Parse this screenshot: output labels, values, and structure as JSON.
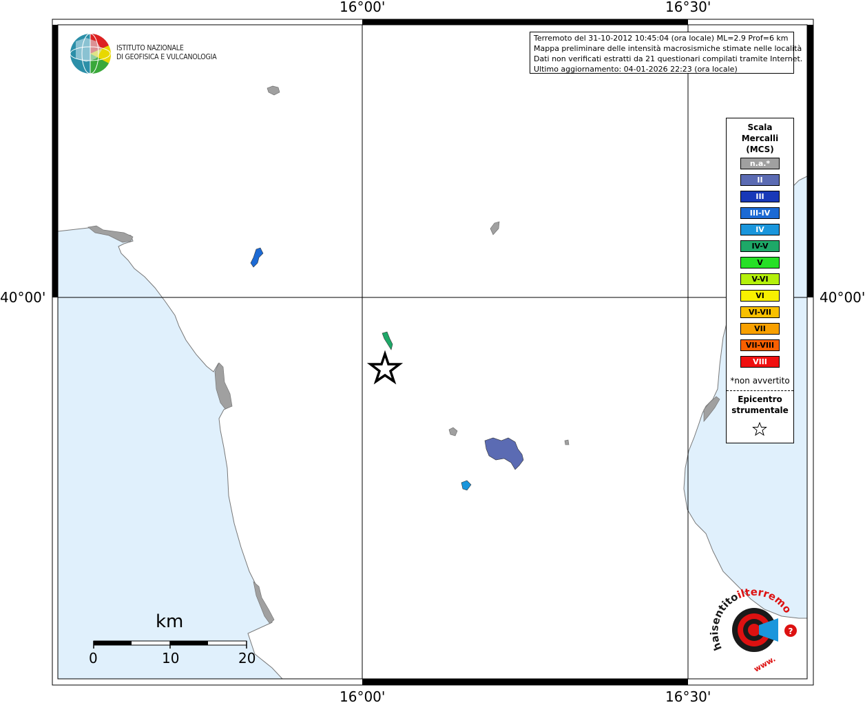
{
  "logo": {
    "line1": "ISTITUTO NAZIONALE",
    "line2": "DI GEOFISICA E VULCANOLOGIA"
  },
  "info": {
    "line1": "Terremoto del 31-10-2012 10:45:04 (ora locale) ML=2.9 Prof=6 km",
    "line2": "Mappa preliminare delle intensità macrosismiche stimate nelle località",
    "line3": "Dati non verificati estratti da 21 questionari compilati tramite Internet.",
    "line4": "Ultimo aggiornamento: 04-01-2026 22:23 (ora locale)"
  },
  "axes": {
    "lon_left": "16°00'",
    "lon_right": "16°30'",
    "lat": "40°00'"
  },
  "legend": {
    "title_line1": "Scala",
    "title_line2": "Mercalli",
    "title_line3": "(MCS)",
    "items": [
      {
        "label": "n.a.*",
        "color": "#a0a0a0"
      },
      {
        "label": "II",
        "color": "#5b6bb3"
      },
      {
        "label": "III",
        "color": "#1838b8"
      },
      {
        "label": "III-IV",
        "color": "#1c6ad4"
      },
      {
        "label": "IV",
        "color": "#1a96dc"
      },
      {
        "label": "IV-V",
        "color": "#1ea868"
      },
      {
        "label": "V",
        "color": "#26e026"
      },
      {
        "label": "V-VI",
        "color": "#b4f00c"
      },
      {
        "label": "VI",
        "color": "#f8f000"
      },
      {
        "label": "VI-VII",
        "color": "#f8c000"
      },
      {
        "label": "VII",
        "color": "#f8a000"
      },
      {
        "label": "VII-VIII",
        "color": "#f86000"
      },
      {
        "label": "VIII",
        "color": "#f01010"
      }
    ],
    "note": "*non avvertito",
    "epicenter_line1": "Epicentro",
    "epicenter_line2": "strumentale"
  },
  "scale": {
    "unit": "km",
    "ticks": [
      "0",
      "10",
      "20"
    ]
  },
  "colors": {
    "sea": "#e0f0fc",
    "land": "#ffffff",
    "locality_na": "#a0a0a0",
    "locality_ii": "#5b6bb3",
    "locality_iii_iv": "#1c6ad4",
    "locality_iv": "#1a96dc",
    "locality_iv_v": "#1ea868"
  }
}
